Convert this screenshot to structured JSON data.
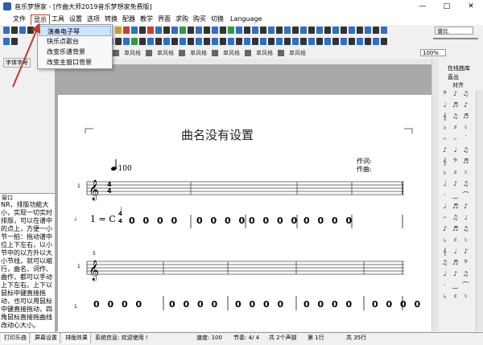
{
  "window": {
    "title": "音乐梦想家 - [作曲大师2019音乐梦想家免费版]",
    "minimize": "—",
    "maximize": "□",
    "close": "✕"
  },
  "menu": {
    "items": [
      "文件",
      "显示",
      "工具",
      "设置",
      "选项",
      "转换",
      "配器",
      "教学",
      "界面",
      "求购",
      "购买",
      "切换",
      "Language"
    ]
  },
  "dropdown": {
    "items": [
      "演奏电子琴",
      "快乐点歌台",
      "改变乐谱背景",
      "改变主窗口背景"
    ]
  },
  "toolbar": {
    "font_label": "字体字号",
    "zoom_value": "100%",
    "mode_value": "谱比",
    "tab_labels": [
      "单风格",
      "单风格",
      "单风格",
      "单风格",
      "单风格",
      "单风格"
    ]
  },
  "left_panel": {
    "title": "窗口",
    "text": "NR，排版功能大小，实现一切实时排版，可以在谱中的点上，方便一小节一拍：拖动谱中位上下左右，以小节中的以方外以大小节线，就可以缩行，曲名、词作、曲作，都可以手动上下左右。上下以鼠标中键直接拖动，也可以用鼠标中键直接拖动，四角鼠标直接拖曲线改动心大小。"
  },
  "score": {
    "title": "曲名没有设置",
    "lyricist": "作词:",
    "composer": "作曲:",
    "tempo": "=100",
    "key": "1 = C",
    "time_sig_top": "4",
    "time_sig_bottom": "4",
    "measure_number": "5",
    "row1_notes": [
      "0 0 0 0",
      "0 0 0 0",
      "0 0 0 0",
      "0 0 0 0"
    ],
    "row2_notes": [
      "0 0 0 0",
      "0 0 0 0",
      "0 0 0 0",
      "0 0 0 0",
      "0 0 0 0"
    ],
    "row_marker": "1"
  },
  "right_panel": {
    "label1": "在线曲库",
    "label2": "直出",
    "label3": "对齐"
  },
  "statusbar": {
    "tabs": [
      "打印乐曲",
      "屏幕设置",
      "排版效果"
    ],
    "system_info": "系统信息: 欢迎使用 !",
    "speed": "速度: 100",
    "beat": "节奏: 4/ 4",
    "voices": "共 2个声部",
    "row": "第 1行",
    "total_rows": "共 35行"
  }
}
